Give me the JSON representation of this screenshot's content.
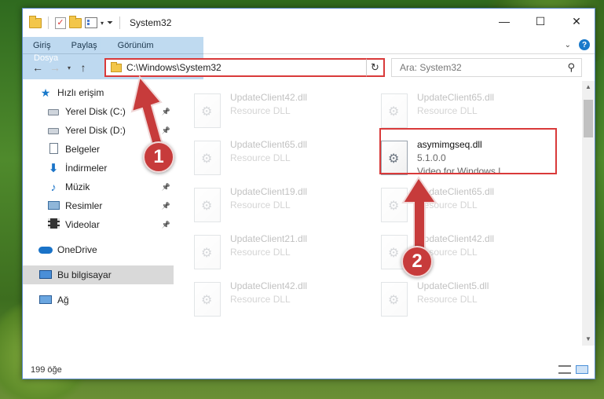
{
  "window": {
    "title": "System32",
    "controls": {
      "minimize": "—",
      "maximize": "☐",
      "close": "✕"
    }
  },
  "ribbon": {
    "tabs": [
      "Dosya",
      "Giriş",
      "Paylaş",
      "Görünüm"
    ],
    "expand_icon": "chevron-down-icon",
    "help_label": "?"
  },
  "nav": {
    "back": "←",
    "forward": "→",
    "recent": "▾",
    "up": "↑",
    "address": "C:\\Windows\\System32",
    "search_placeholder": "Ara: System32"
  },
  "sidebar": {
    "items": [
      {
        "label": "Hızlı erişim",
        "icon": "star-icon",
        "level": 0,
        "pinned": false
      },
      {
        "label": "Yerel Disk (C:)",
        "icon": "drive-icon",
        "level": 1,
        "pinned": true
      },
      {
        "label": "Yerel Disk (D:)",
        "icon": "drive-icon",
        "level": 1,
        "pinned": true
      },
      {
        "label": "Belgeler",
        "icon": "documents-icon",
        "level": 1,
        "pinned": true
      },
      {
        "label": "İndirmeler",
        "icon": "downloads-icon",
        "level": 1,
        "pinned": true
      },
      {
        "label": "Müzik",
        "icon": "music-icon",
        "level": 1,
        "pinned": true
      },
      {
        "label": "Resimler",
        "icon": "pictures-icon",
        "level": 1,
        "pinned": true
      },
      {
        "label": "Videolar",
        "icon": "videos-icon",
        "level": 1,
        "pinned": true
      },
      {
        "label": "OneDrive",
        "icon": "cloud-icon",
        "level": 0,
        "pinned": false
      },
      {
        "label": "Bu bilgisayar",
        "icon": "computer-icon",
        "level": 0,
        "pinned": false,
        "selected": true
      },
      {
        "label": "Ağ",
        "icon": "network-icon",
        "level": 0,
        "pinned": false
      }
    ]
  },
  "files": [
    {
      "name": "UpdateClient42.dll",
      "sub": "Resource DLL"
    },
    {
      "name": "UpdateClient65.dll",
      "sub": "Resource DLL"
    },
    {
      "name": "UpdateClient65.dll",
      "sub": "Resource DLL"
    },
    {
      "name": "asymimgseq.dll",
      "version": "5.1.0.0",
      "sub": "Video for Windows I...",
      "highlighted": true
    },
    {
      "name": "UpdateClient19.dll",
      "sub": "Resource DLL"
    },
    {
      "name": "UpdateClient65.dll",
      "sub": "Resource DLL"
    },
    {
      "name": "UpdateClient21.dll",
      "sub": "Resource DLL"
    },
    {
      "name": "UpdateClient42.dll",
      "sub": "Resource DLL"
    },
    {
      "name": "UpdateClient42.dll",
      "sub": "Resource DLL"
    },
    {
      "name": "UpdateClient5.dll",
      "sub": "Resource DLL"
    }
  ],
  "status": {
    "item_count": "199 öğe"
  },
  "annotations": {
    "step1": "1",
    "step2": "2",
    "color": "#c73b3b"
  }
}
